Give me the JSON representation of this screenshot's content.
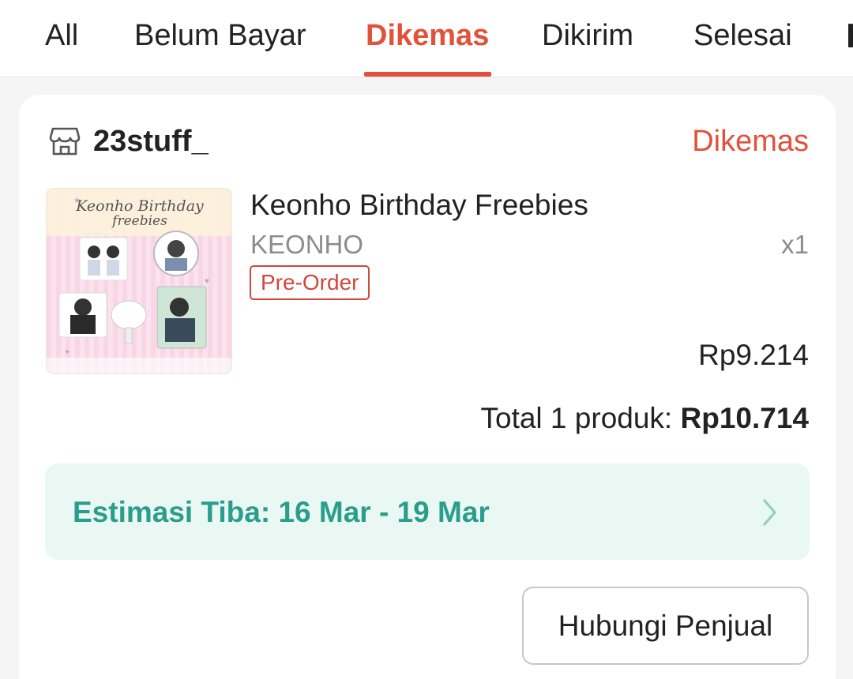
{
  "tabs": [
    {
      "label": "All",
      "active": false
    },
    {
      "label": "Belum Bayar",
      "active": false
    },
    {
      "label": "Dikemas",
      "active": true
    },
    {
      "label": "Dikirim",
      "active": false
    },
    {
      "label": "Selesai",
      "active": false
    }
  ],
  "accent_color": "#e2513a",
  "order": {
    "shop_icon": "shop-icon",
    "shop_name": "23stuff_",
    "status": "Dikemas",
    "product": {
      "thumbnail_title": "Keonho Birthday freebies",
      "name": "Keonho Birthday Freebies",
      "variant": "KEONHO",
      "quantity": "x1",
      "badge": "Pre-Order",
      "price": "Rp9.214"
    },
    "total_label": "Total 1 produk:",
    "total_value": "Rp10.714",
    "estimate": {
      "text": "Estimasi Tiba: 16 Mar - 19 Mar",
      "color": "#2a9d8c",
      "icon": "chevron-right-icon"
    },
    "contact_button": "Hubungi Penjual"
  }
}
